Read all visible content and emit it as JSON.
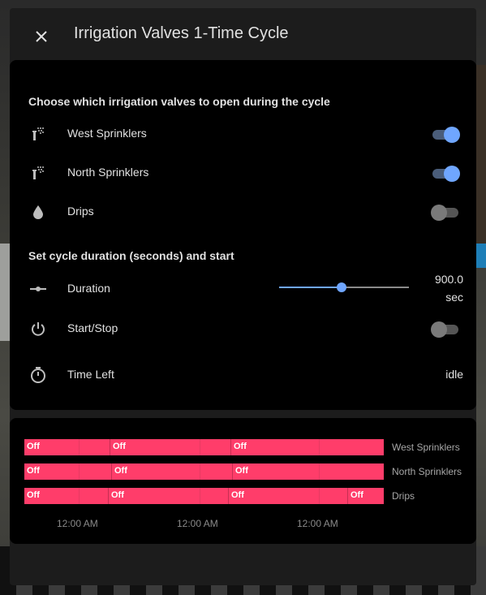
{
  "dialog": {
    "title": "Irrigation Valves 1-Time Cycle"
  },
  "valves_section": {
    "heading": "Choose which irrigation valves to open during the cycle",
    "items": [
      {
        "label": "West Sprinklers",
        "icon": "sprinkler-icon",
        "state": "on"
      },
      {
        "label": "North Sprinklers",
        "icon": "sprinkler-icon",
        "state": "on"
      },
      {
        "label": "Drips",
        "icon": "water-drop-icon",
        "state": "off"
      }
    ]
  },
  "cycle_section": {
    "heading": "Set cycle duration (seconds) and start",
    "duration": {
      "label": "Duration",
      "value": "900.0",
      "unit": "sec",
      "slider_fraction": 0.48
    },
    "start_stop": {
      "label": "Start/Stop",
      "state": "off"
    },
    "time_left": {
      "label": "Time Left",
      "value": "idle"
    }
  },
  "history": {
    "rows": [
      {
        "name": "West Sprinklers",
        "segments": [
          "Off",
          "Off",
          "Off"
        ]
      },
      {
        "name": "North Sprinklers",
        "segments": [
          "Off",
          "Off",
          "Off"
        ]
      },
      {
        "name": "Drips",
        "segments": [
          "Off",
          "Off",
          "Off",
          "Off"
        ]
      }
    ],
    "ticks": [
      "12:00 AM",
      "12:00 AM",
      "12:00 AM"
    ],
    "color": "#ff3d6a"
  },
  "colors": {
    "accent": "#6fa6ff",
    "card_bg": "#000000",
    "dialog_bg": "#1c1c1c"
  }
}
